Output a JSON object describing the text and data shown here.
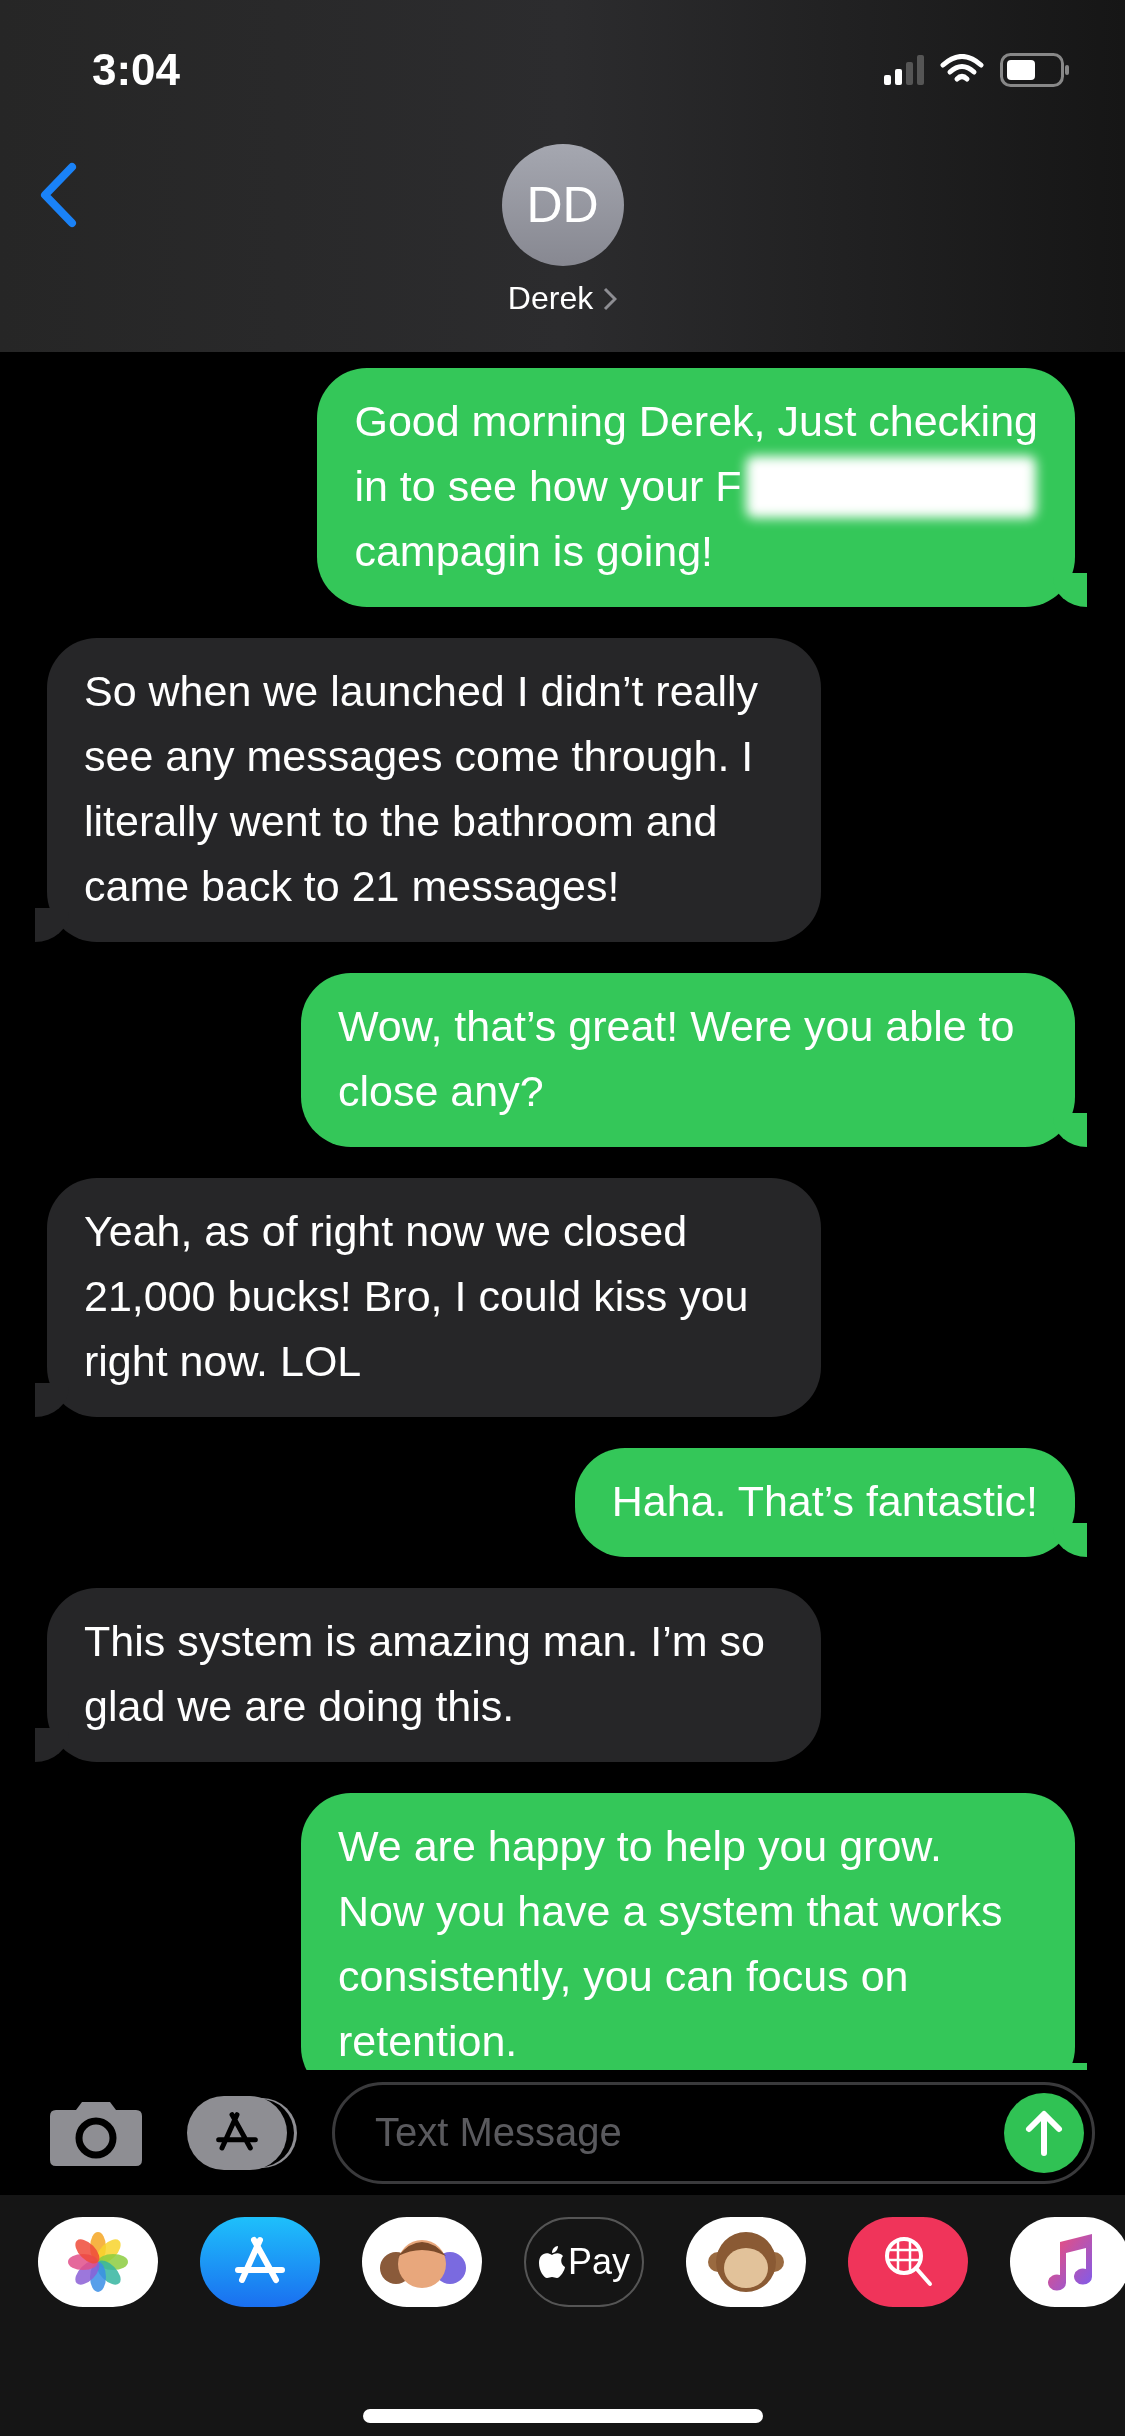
{
  "status_bar": {
    "time": "3:04"
  },
  "contact": {
    "initials": "DD",
    "name": "Derek"
  },
  "messages": [
    {
      "sent": true,
      "kind": "redacted",
      "parts": [
        {
          "text": "Good morning Derek, Just checking",
          "redacted": false
        },
        {
          "text": "in to see how your F",
          "redacted": true
        },
        {
          "text": "campagin is going!",
          "redacted": false
        }
      ]
    },
    {
      "sent": false,
      "kind": "plain",
      "text": "So when we launched I didn’t really see any messages come through. I literally went to the bathroom and came back to 21 messages!"
    },
    {
      "sent": true,
      "kind": "plain",
      "text": "Wow, that’s great! Were you able to close any?"
    },
    {
      "sent": false,
      "kind": "plain",
      "text": "Yeah, as of right now we closed 21,000 bucks! Bro, I could kiss you right now. LOL"
    },
    {
      "sent": true,
      "kind": "plain",
      "text": "Haha. That’s fantastic!"
    },
    {
      "sent": false,
      "kind": "plain",
      "text": "This system is amazing man. I’m so glad we are doing this."
    },
    {
      "sent": true,
      "kind": "plain",
      "text": "We are happy to help you grow. Now you have a system that works consistently, you can focus on retention."
    }
  ],
  "composer": {
    "placeholder": "Text Message"
  },
  "apps": [
    {
      "kind": "photos"
    },
    {
      "kind": "store"
    },
    {
      "kind": "memoji"
    },
    {
      "kind": "pay",
      "label": "Pay"
    },
    {
      "kind": "animoji"
    },
    {
      "kind": "images"
    },
    {
      "kind": "music"
    }
  ]
}
